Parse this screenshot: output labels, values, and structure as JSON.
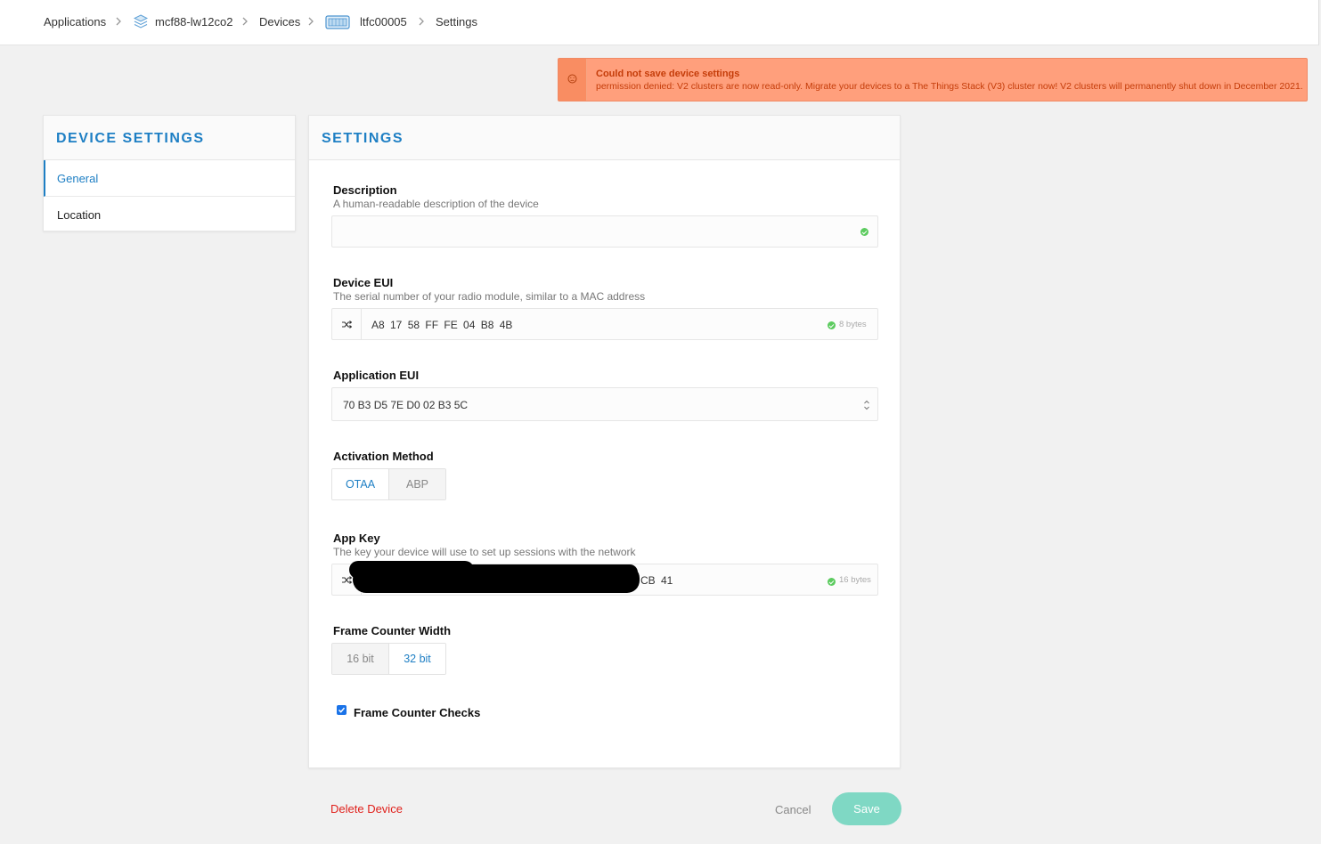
{
  "breadcrumb": {
    "items": [
      "Applications",
      "mcf88-lw12co2",
      "Devices",
      "ltfc00005",
      "Settings"
    ]
  },
  "alert": {
    "title": "Could not save device settings",
    "message": "permission denied: V2 clusters are now read-only. Migrate your devices to a The Things Stack (V3) cluster now! V2 clusters will permanently shut down in December 2021."
  },
  "sidebar": {
    "title": "DEVICE SETTINGS",
    "items": [
      {
        "label": "General",
        "active": true
      },
      {
        "label": "Location",
        "active": false
      }
    ]
  },
  "settings": {
    "title": "SETTINGS",
    "description": {
      "label": "Description",
      "help": "A human-readable description of the device",
      "value": ""
    },
    "device_eui": {
      "label": "Device EUI",
      "help": "The serial number of your radio module, similar to a MAC address",
      "value": "A8 17 58 FF FE 04 B8 4B",
      "bytes": "8 bytes"
    },
    "app_eui": {
      "label": "Application EUI",
      "value": "70 B3 D5 7E D0 02 B3 5C"
    },
    "activation": {
      "label": "Activation Method",
      "options": [
        "OTAA",
        "ABP"
      ],
      "selected": "OTAA"
    },
    "app_key": {
      "label": "App Key",
      "help": "The key your device will use to set up sessions with the network",
      "visible_tail": "CB 41",
      "bytes": "16 bytes"
    },
    "frame_counter_width": {
      "label": "Frame Counter Width",
      "options": [
        "16 bit",
        "32 bit"
      ],
      "selected": "32 bit"
    },
    "frame_counter_checks": {
      "label": "Frame Counter Checks",
      "checked": true
    }
  },
  "actions": {
    "delete": "Delete Device",
    "cancel": "Cancel",
    "save": "Save"
  },
  "colors": {
    "accent": "#1e7fc4",
    "alert_bg": "#ff9f7c",
    "alert_text": "#c53d0a",
    "save_button": "#7fd8c4",
    "delete": "#e0201b"
  }
}
